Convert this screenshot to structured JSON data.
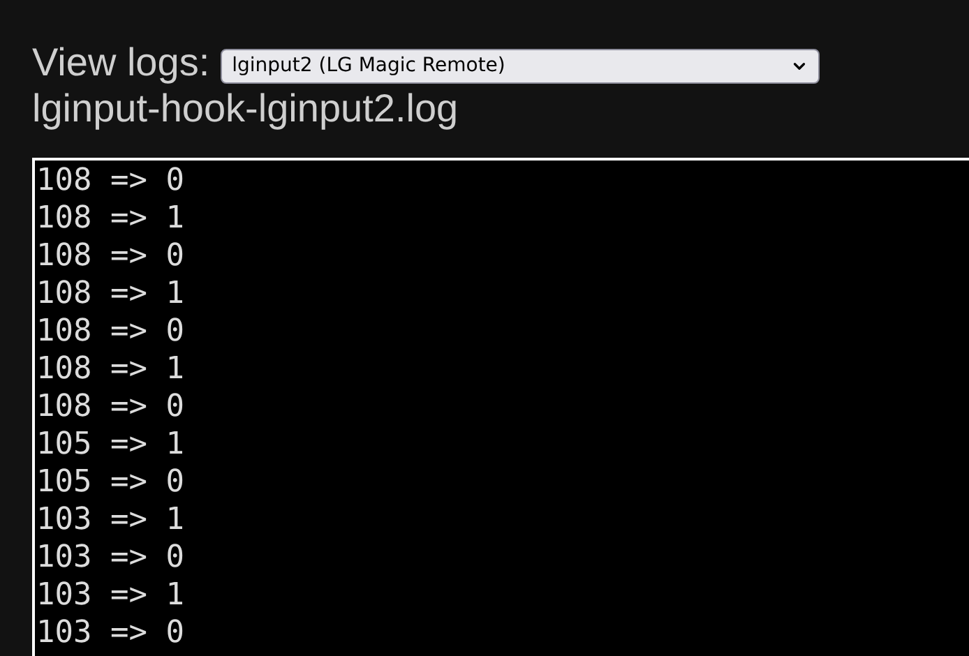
{
  "header": {
    "label": "View logs:",
    "selected_log": "lginput2 (LG Magic Remote)"
  },
  "file_name": "lginput-hook-lginput2.log",
  "log_lines": [
    "108 => 0",
    "108 => 1",
    "108 => 0",
    "108 => 1",
    "108 => 0",
    "108 => 1",
    "108 => 0",
    "105 => 1",
    "105 => 0",
    "103 => 1",
    "103 => 0",
    "103 => 1",
    "103 => 0"
  ]
}
